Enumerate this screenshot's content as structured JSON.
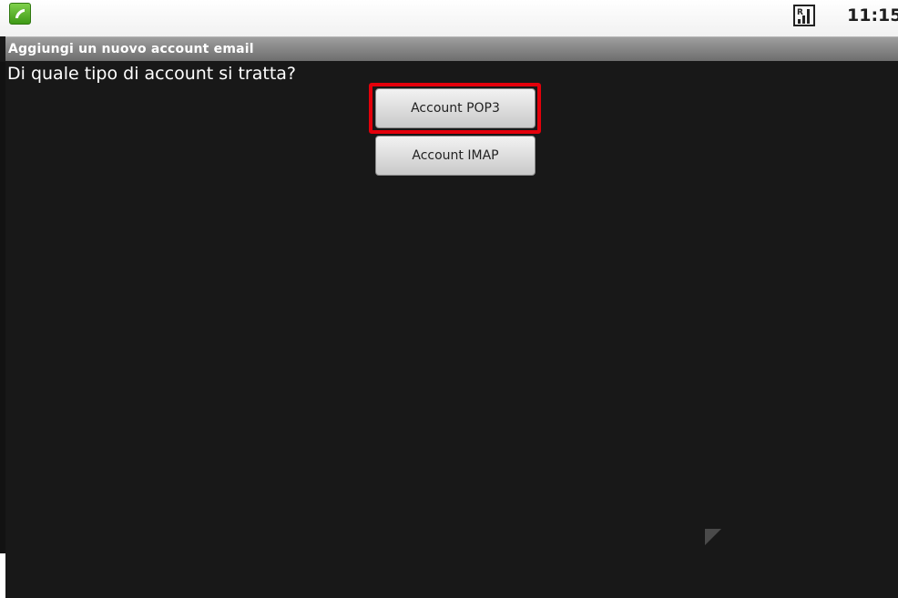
{
  "status_bar": {
    "notification_icon": "phone-icon",
    "signal_icon": "roaming-signal-icon",
    "signal_label": "R",
    "time": "11:15"
  },
  "title_bar": {
    "title": "Aggiungi un nuovo account email"
  },
  "content": {
    "question": "Di quale tipo di account si tratta?",
    "buttons": [
      {
        "label": "Account POP3",
        "highlighted": true
      },
      {
        "label": "Account IMAP",
        "highlighted": false
      }
    ]
  },
  "colors": {
    "background": "#181818",
    "highlight": "#e4000b",
    "title_bar": "#8a8a8a",
    "status_bar": "#f5f5f5"
  }
}
